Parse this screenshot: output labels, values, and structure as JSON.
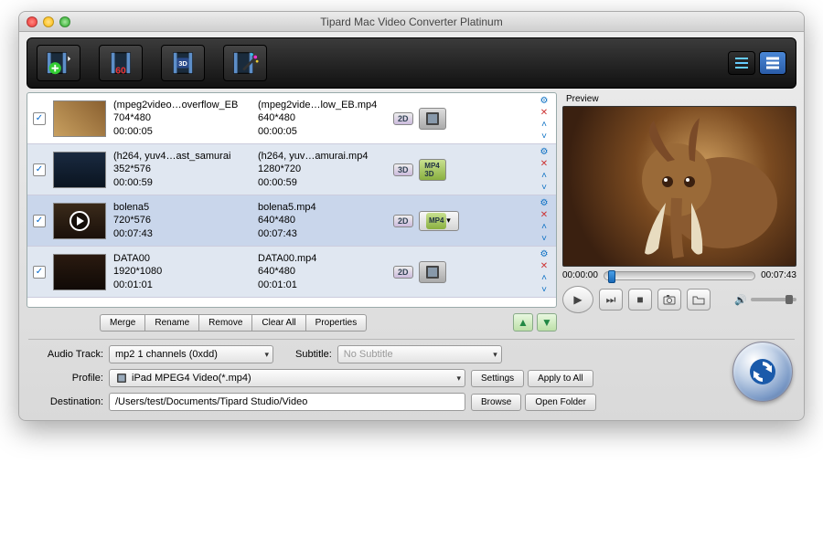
{
  "window": {
    "title": "Tipard Mac Video Converter Platinum"
  },
  "preview": {
    "label": "Preview",
    "current_time": "00:00:00",
    "total_time": "00:07:43"
  },
  "toolbar": {
    "add": "add-file",
    "trim": "trim-60",
    "threed": "3D",
    "effect": "effect"
  },
  "list_actions": {
    "merge": "Merge",
    "rename": "Rename",
    "remove": "Remove",
    "clear_all": "Clear All",
    "properties": "Properties"
  },
  "items": [
    {
      "checked": true,
      "src_name": "(mpeg2video…overflow_EB",
      "src_res": "704*480",
      "src_dur": "00:00:05",
      "out_name": "(mpeg2vide…low_EB.mp4",
      "out_res": "640*480",
      "out_dur": "00:00:05",
      "mode": "2D",
      "device": "ipad"
    },
    {
      "checked": true,
      "src_name": "(h264, yuv4…ast_samurai",
      "src_res": "352*576",
      "src_dur": "00:00:59",
      "out_name": "(h264, yuv…amurai.mp4",
      "out_res": "1280*720",
      "out_dur": "00:00:59",
      "mode": "3D",
      "device": "mp4-3d"
    },
    {
      "checked": true,
      "src_name": "bolena5",
      "src_res": "720*576",
      "src_dur": "00:07:43",
      "out_name": "bolena5.mp4",
      "out_res": "640*480",
      "out_dur": "00:07:43",
      "mode": "2D",
      "device": "mp4-3d-dropdown"
    },
    {
      "checked": true,
      "src_name": "DATA00",
      "src_res": "1920*1080",
      "src_dur": "00:01:01",
      "out_name": "DATA00.mp4",
      "out_res": "640*480",
      "out_dur": "00:01:01",
      "mode": "2D",
      "device": "ipad"
    }
  ],
  "form": {
    "audio_track_label": "Audio Track:",
    "audio_track_value": "mp2 1 channels (0xdd)",
    "subtitle_label": "Subtitle:",
    "subtitle_value": "No Subtitle",
    "profile_label": "Profile:",
    "profile_value": "iPad MPEG4 Video(*.mp4)",
    "destination_label": "Destination:",
    "destination_value": "/Users/test/Documents/Tipard Studio/Video",
    "settings": "Settings",
    "apply_all": "Apply to All",
    "browse": "Browse",
    "open_folder": "Open Folder"
  }
}
